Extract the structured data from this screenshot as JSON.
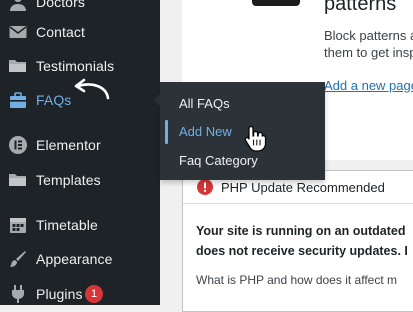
{
  "sidebar": {
    "items": [
      {
        "label": "Doctors",
        "icon": "doctors-icon"
      },
      {
        "label": "Contact",
        "icon": "envelope-icon"
      },
      {
        "label": "Testimonials",
        "icon": "folder-icon"
      },
      {
        "label": "FAQs",
        "icon": "briefcase-icon"
      },
      {
        "label": "Elementor",
        "icon": "elementor-icon"
      },
      {
        "label": "Templates",
        "icon": "folder-icon"
      },
      {
        "label": "Timetable",
        "icon": "calendar-icon"
      },
      {
        "label": "Appearance",
        "icon": "paintbrush-icon"
      },
      {
        "label": "Plugins",
        "icon": "plugin-icon",
        "badge": "1"
      }
    ]
  },
  "faqs_submenu": {
    "items": [
      "All FAQs",
      "Add New",
      "Faq Category"
    ],
    "current": "Add New"
  },
  "patterns_panel": {
    "title": "patterns",
    "description_line1": "Block patterns are",
    "description_line2": "them to get inspir",
    "link": "Add a new page"
  },
  "php_notice": {
    "title": "PHP Update Recommended",
    "body_line1": "Your site is running on an outdated",
    "body_line2": "does not receive security updates. I",
    "question": "What is PHP and how does it affect m"
  },
  "colors": {
    "sidebar_bg": "#1d2327",
    "flyout_bg": "#2c3338",
    "accent": "#72aee6",
    "link": "#2271b1",
    "alert": "#d63638"
  }
}
